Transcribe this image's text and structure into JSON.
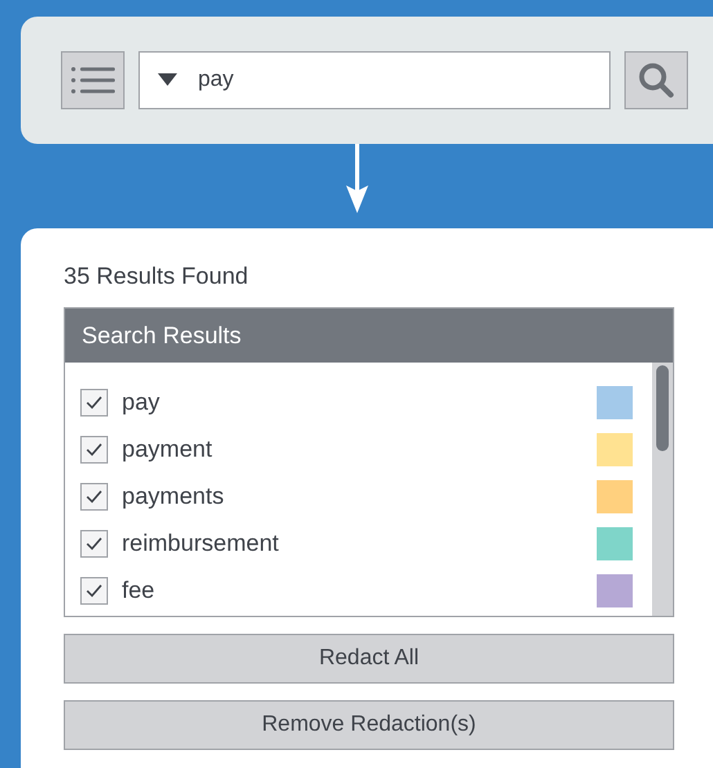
{
  "search": {
    "value": "pay"
  },
  "results_count": "35 Results Found",
  "results_panel": {
    "title": "Search Results",
    "items": [
      {
        "label": "pay",
        "checked": true,
        "color": "#a3c9ea"
      },
      {
        "label": "payment",
        "checked": true,
        "color": "#ffe291"
      },
      {
        "label": "payments",
        "checked": true,
        "color": "#ffd07e"
      },
      {
        "label": "reimbursement",
        "checked": true,
        "color": "#7fd5c9"
      },
      {
        "label": "fee",
        "checked": true,
        "color": "#b5a8d5"
      }
    ]
  },
  "buttons": [
    "Redact All",
    "Remove Redaction(s)"
  ]
}
